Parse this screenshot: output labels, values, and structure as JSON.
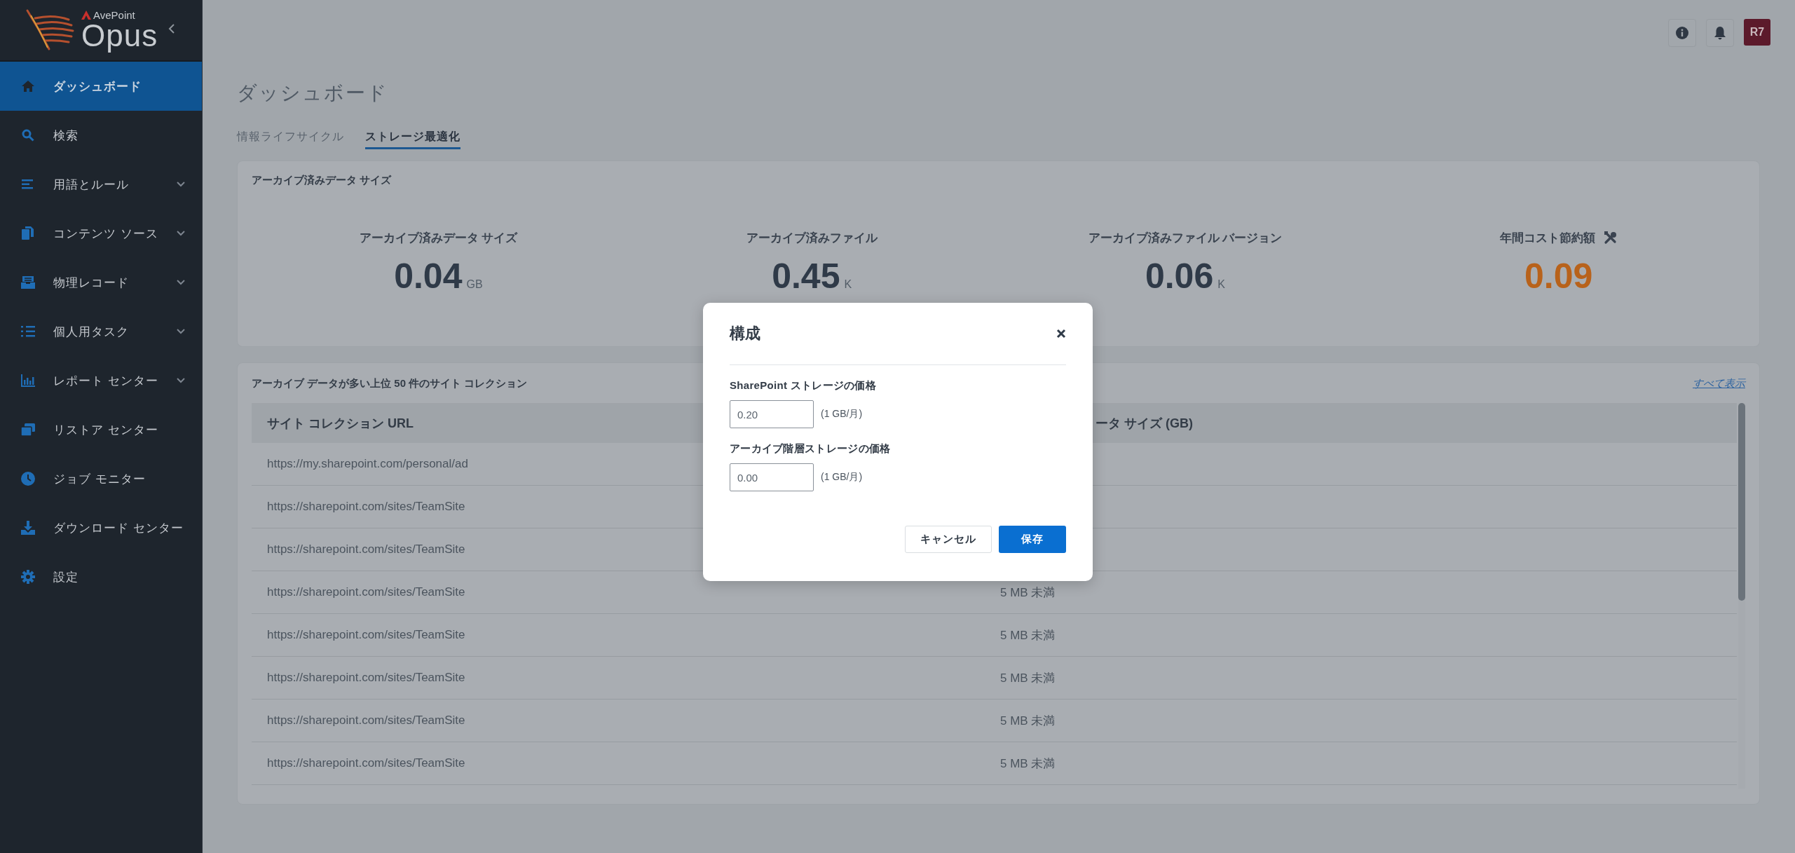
{
  "sidebar": {
    "logo": {
      "brand": "AvePoint",
      "product": "Opus"
    },
    "items": [
      {
        "label": "ダッシュボード",
        "selected": true,
        "expandable": false
      },
      {
        "label": "検索",
        "selected": false,
        "expandable": false
      },
      {
        "label": "用語とルール",
        "selected": false,
        "expandable": true
      },
      {
        "label": "コンテンツ ソース",
        "selected": false,
        "expandable": true
      },
      {
        "label": "物理レコード",
        "selected": false,
        "expandable": true
      },
      {
        "label": "個人用タスク",
        "selected": false,
        "expandable": true
      },
      {
        "label": "レポート センター",
        "selected": false,
        "expandable": true
      },
      {
        "label": "リストア センター",
        "selected": false,
        "expandable": false
      },
      {
        "label": "ジョブ モニター",
        "selected": false,
        "expandable": false
      },
      {
        "label": "ダウンロード センター",
        "selected": false,
        "expandable": false
      },
      {
        "label": "設定",
        "selected": false,
        "expandable": false
      }
    ]
  },
  "header": {
    "avatar": "R7"
  },
  "page_title": "ダッシュボード",
  "tabs": [
    {
      "label": "情報ライフサイクル",
      "selected": false
    },
    {
      "label": "ストレージ最適化",
      "selected": true
    }
  ],
  "summary": {
    "title": "アーカイブ済みデータ サイズ",
    "stats": [
      {
        "kind": "size",
        "label": "アーカイブ済みデータ サイズ",
        "value": "0.04",
        "unit": "GB",
        "color": "#2f3a48"
      },
      {
        "kind": "size",
        "label": "アーカイブ済みファイル",
        "value": "0.45",
        "unit": "K",
        "color": "#2f3a48"
      },
      {
        "kind": "size",
        "label": "アーカイブ済みファイル バージョン",
        "value": "0.06",
        "unit": "K",
        "color": "#2f3a48"
      },
      {
        "kind": "cost",
        "label": "年間コスト節約額",
        "value": "0.09",
        "color": "#b8621b"
      }
    ]
  },
  "table_card": {
    "title": "アーカイブ データが多い上位 50 件のサイト コレクション",
    "link": "すべて表示",
    "columns": [
      "サイト コレクション URL",
      "ータ サイズ (GB)"
    ],
    "rows": [
      {
        "url": "https://my.sharepoint.com/personal/ad"
      },
      {
        "url": "https://sharepoint.com/sites/TeamSite"
      },
      {
        "url": "https://sharepoint.com/sites/TeamSite"
      },
      {
        "url": "https://sharepoint.com/sites/TeamSite",
        "size": "5 MB 未満"
      },
      {
        "url": "https://sharepoint.com/sites/TeamSite",
        "size": "5 MB 未満"
      },
      {
        "url": "https://sharepoint.com/sites/TeamSite",
        "size": "5 MB 未満"
      },
      {
        "url": "https://sharepoint.com/sites/TeamSite",
        "size": "5 MB 未満"
      },
      {
        "url": "https://sharepoint.com/sites/TeamSite",
        "size": "5 MB 未満"
      }
    ]
  },
  "dialog": {
    "title": "構成",
    "fields": [
      {
        "label": "SharePoint ストレージの価格",
        "value": "0.20",
        "unit": "(1 GB/月)"
      },
      {
        "label": "アーカイブ階層ストレージの価格",
        "value": "0.00",
        "unit": "(1 GB/月)"
      }
    ],
    "buttons": [
      {
        "kind": "secondary",
        "label": "キャンセル"
      },
      {
        "kind": "primary",
        "label": "保存"
      }
    ]
  }
}
